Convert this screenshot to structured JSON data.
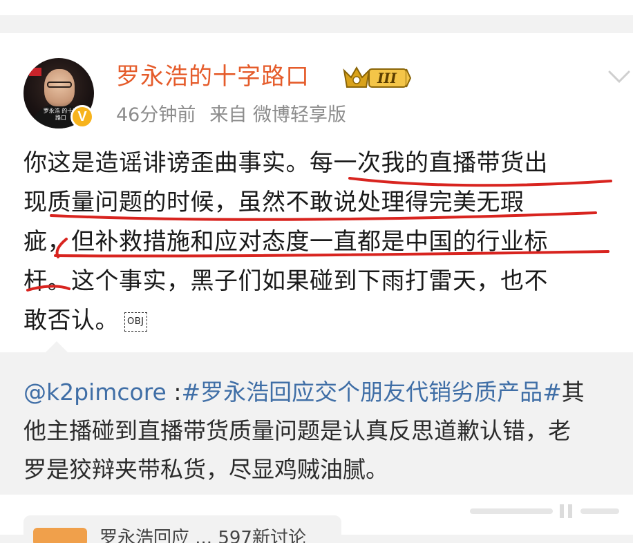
{
  "post": {
    "username": "罗永浩的十字路口",
    "level_badge": "III",
    "time_ago": "46分钟前",
    "source": "来自 微博轻享版",
    "verified_badge": "V",
    "avatar_caption": "罗永浩 的十字路口",
    "text_lines": [
      "你这是造谣诽谤歪曲事实。每一次我的直播带货出",
      "现质量问题的时候，虽然不敢说处理得完美无瑕",
      "疵，但补救措施和应对态度一直都是中国的行业标",
      "杆。这个事实，黑子们如果碰到下雨打雷天，也不",
      "敢否认。"
    ],
    "obj_chip": "OBJ"
  },
  "repost": {
    "mention": "@k2pimcore",
    "colon": " :",
    "topic": "#罗永浩回应交个朋友代销劣质产品#",
    "line1_rest": "其",
    "line2": "他主播碰到直播带货质量问题是认真反思道歉认错，老",
    "line3": "罗是狡辩夹带私货，尽显鸡贼油腻。"
  },
  "bottom": {
    "card_text": "罗永浩回应 ... 597新讨论"
  },
  "colors": {
    "username": "#e55c2b",
    "link": "#3f6ea6",
    "meta": "#8c8c8c",
    "underline": "#d8241f",
    "verified": "#f7b31c"
  }
}
